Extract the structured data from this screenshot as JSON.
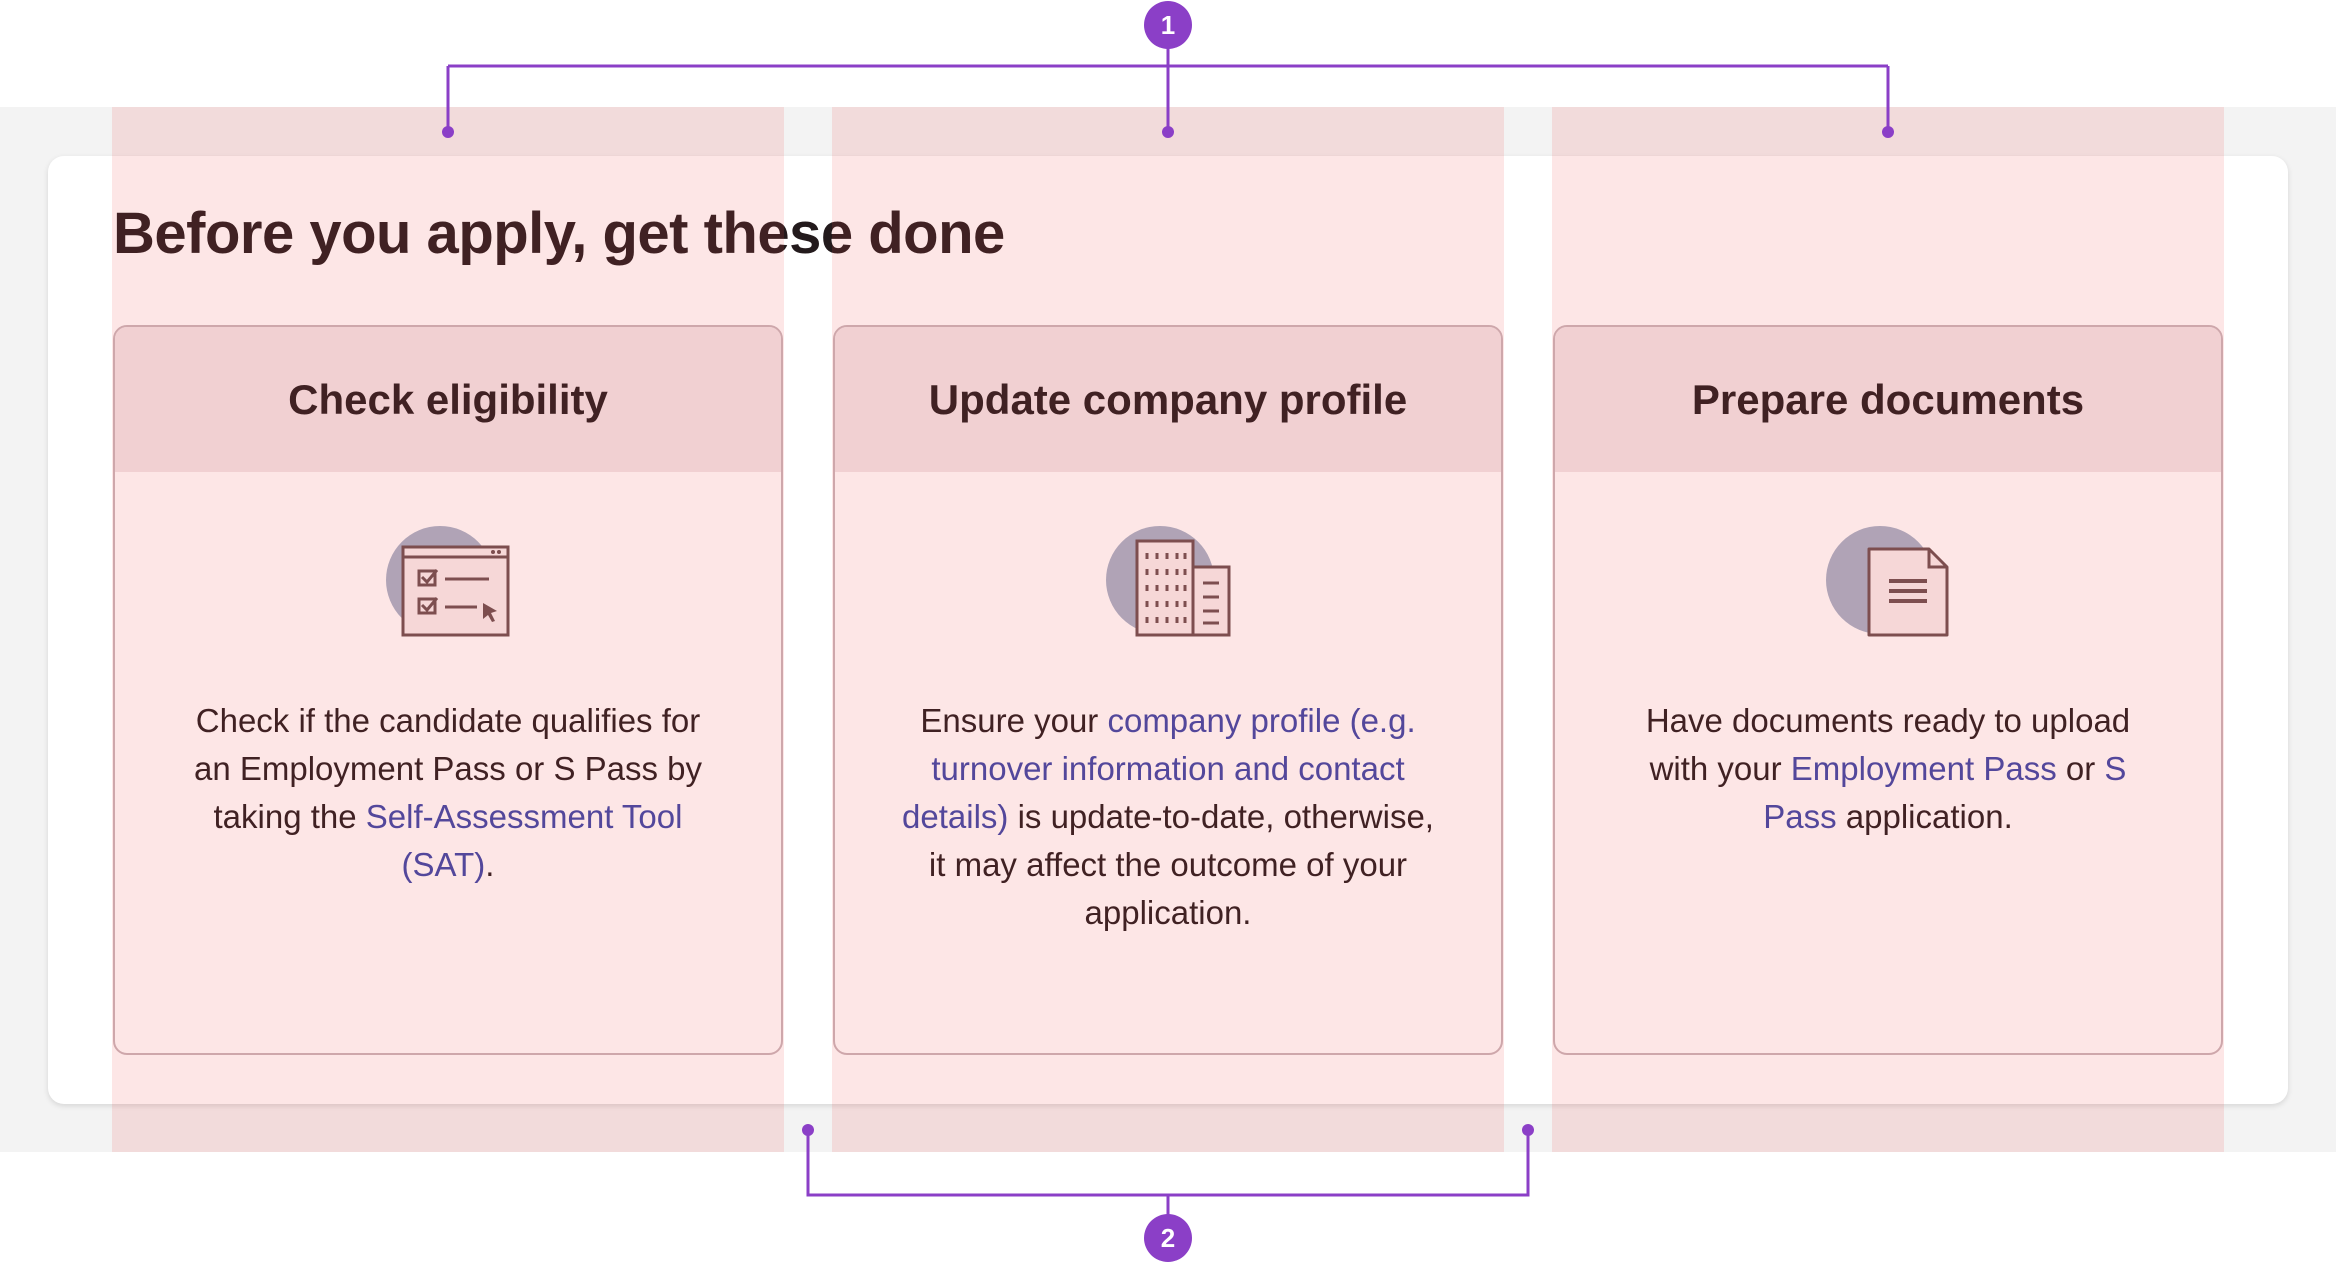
{
  "page_title": "Before you apply, get these done",
  "colors": {
    "accent": "#8b3fc7",
    "link": "#3a46a8",
    "tile_header": "#f1e6e8",
    "overlay": "#f05050"
  },
  "annotations": {
    "badge_1": "1",
    "badge_2": "2"
  },
  "tiles": [
    {
      "title": "Check eligibility",
      "icon": "checklist-icon",
      "body": {
        "t1": "Check if the candidate qualifies for an Employment Pass or S Pass by taking the ",
        "link1": "Self-Assessment Tool (SAT)",
        "t2": "."
      }
    },
    {
      "title": "Update company profile",
      "icon": "building-icon",
      "body": {
        "t1": "Ensure your ",
        "link1": "company profile (e.g. turnover information and contact details)",
        "t2": " is update-to-date, otherwise, it may affect the outcome of your application."
      }
    },
    {
      "title": "Prepare documents",
      "icon": "document-icon",
      "body": {
        "t1": "Have documents ready to upload with your ",
        "link1": "Employment Pass",
        "t2": " or ",
        "link2": "S Pass",
        "t3": " application."
      }
    }
  ]
}
